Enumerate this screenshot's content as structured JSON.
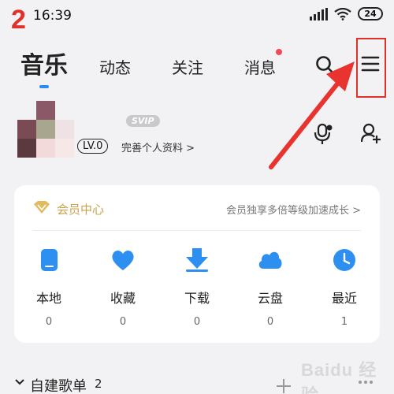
{
  "annotation": {
    "step": "2"
  },
  "status_bar": {
    "time": "16:39",
    "battery": "24"
  },
  "nav": {
    "tabs": [
      {
        "label": "音乐",
        "active": true
      },
      {
        "label": "动态"
      },
      {
        "label": "关注"
      },
      {
        "label": "消息",
        "has_dot": true
      }
    ],
    "search_icon": "search-icon",
    "menu_icon": "hamburger-menu-icon"
  },
  "profile": {
    "badge": "SVIP",
    "level": "LV.0",
    "complete_profile": "完善个人资料 >"
  },
  "vip": {
    "title": "会员中心",
    "promo": "会员独享多倍等级加速成长 >"
  },
  "quick_access": [
    {
      "label": "本地",
      "count": "0",
      "icon": "local-music-icon"
    },
    {
      "label": "收藏",
      "count": "0",
      "icon": "heart-icon"
    },
    {
      "label": "下载",
      "count": "0",
      "icon": "download-icon"
    },
    {
      "label": "云盘",
      "count": "0",
      "icon": "cloud-icon"
    },
    {
      "label": "最近",
      "count": "1",
      "icon": "clock-icon"
    }
  ],
  "playlist": {
    "title": "自建歌单",
    "count": "2"
  },
  "watermark": "Baidu 经验",
  "colors": {
    "accent": "#2a8cf0",
    "icon_blue": "#2d8ff0",
    "vip_gold": "#c9a24a",
    "annotation_red": "#e0302b",
    "badge_red": "#ef4a55"
  }
}
